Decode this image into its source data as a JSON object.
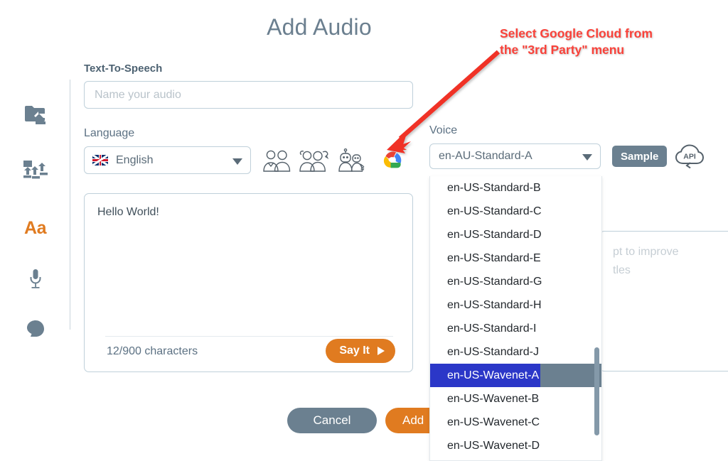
{
  "page_title": "Add Audio",
  "annotation": {
    "line1": "Select Google Cloud from",
    "line2": "the \"3rd Party\" menu",
    "color": "#f9423a"
  },
  "sidebar": {
    "items": [
      {
        "name": "folder-upload-icon",
        "label": "",
        "active": false
      },
      {
        "name": "media-upload-icon",
        "label": "",
        "active": false
      },
      {
        "name": "text-tool-icon",
        "label": "Aa",
        "active": true
      },
      {
        "name": "microphone-icon",
        "label": "",
        "active": false
      },
      {
        "name": "voiceover-head-icon",
        "label": "",
        "active": false
      }
    ]
  },
  "tts": {
    "section_label": "Text-To-Speech",
    "name_placeholder": "Name your audio",
    "name_value": "",
    "language_label": "Language",
    "language_value": "English",
    "language_flag": "uk-flag-icon",
    "voice_type_icons": [
      "standard-voices-icon",
      "neural-voices-icon",
      "ai-robot-voices-icon",
      "google-cloud-icon"
    ],
    "text_value": "Hello World!",
    "char_counter": "12/900 characters",
    "say_it_label": "Say It"
  },
  "voice": {
    "label": "Voice",
    "selected": "en-AU-Standard-A",
    "sample_label": "Sample",
    "api_icon_label": "API",
    "options": [
      "en-US-Standard-B",
      "en-US-Standard-C",
      "en-US-Standard-D",
      "en-US-Standard-E",
      "en-US-Standard-G",
      "en-US-Standard-H",
      "en-US-Standard-I",
      "en-US-Standard-J",
      "en-US-Wavenet-A",
      "en-US-Wavenet-B",
      "en-US-Wavenet-C",
      "en-US-Wavenet-D"
    ],
    "highlighted_option": "en-US-Wavenet-A"
  },
  "right_panel": {
    "placeholder_line1": "pt to improve",
    "placeholder_line2": "tles"
  },
  "footer": {
    "cancel_label": "Cancel",
    "add_label": "Add"
  },
  "colors": {
    "accent_orange": "#e07b20",
    "slate": "#6b8090",
    "title": "#6b7f8f",
    "annotation_red": "#f9423a",
    "selection_blue": "#2b37c8"
  }
}
